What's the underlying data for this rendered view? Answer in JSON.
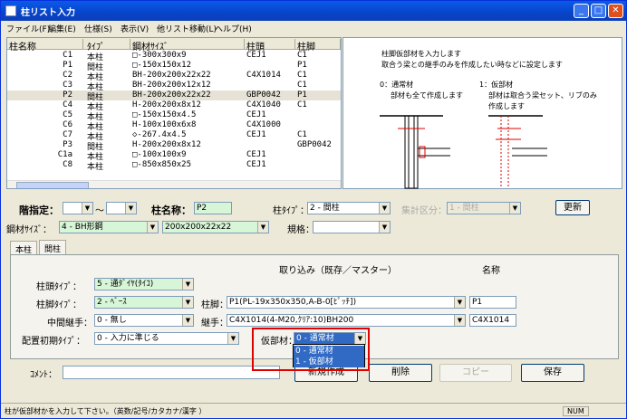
{
  "window": {
    "title": "柱リスト入力"
  },
  "menu": [
    "ファイル(F)",
    "編集(E)",
    "仕様(S)",
    "表示(V)",
    "他リスト移動(L)",
    "ヘルプ(H)"
  ],
  "list": {
    "headers": [
      "柱名称",
      "ﾀｲﾌﾟ",
      "鋼材ｻｲｽﾞ",
      "柱頭",
      "柱脚"
    ],
    "rows": [
      [
        "C1",
        "本柱",
        "□-300x300x9",
        "CEJ1",
        "C1"
      ],
      [
        "P1",
        "間柱",
        "□-150x150x12",
        "",
        "P1"
      ],
      [
        "C2",
        "本柱",
        "BH-200x200x22x22",
        "C4X1014",
        "C1"
      ],
      [
        "C3",
        "本柱",
        "BH-200x200x12x12",
        "",
        "C1"
      ],
      [
        "P2",
        "間柱",
        "BH-200x200x22x22",
        "GBP0042",
        "P1"
      ],
      [
        "C4",
        "本柱",
        "H-200x200x8x12",
        "C4X1040",
        "C1"
      ],
      [
        "C5",
        "本柱",
        "□-150x150x4.5",
        "CEJ1",
        ""
      ],
      [
        "C6",
        "本柱",
        "H-100x100x6x8",
        "C4X1000",
        ""
      ],
      [
        "C7",
        "本柱",
        "◇-267.4x4.5",
        "CEJ1",
        "C1"
      ],
      [
        "P3",
        "間柱",
        "H-200x200x8x12",
        "",
        "GBP0042"
      ],
      [
        "C1a",
        "本柱",
        "□-100x100x9",
        "CEJ1",
        ""
      ],
      [
        "C8",
        "本柱",
        "□-850x850x25",
        "CEJ1",
        ""
      ]
    ]
  },
  "diagram": {
    "note1": "柱脚仮部材を入力します",
    "note2": "取合う梁との継手のみを作成したい時などに設定します",
    "left_title": "0：通常材",
    "left_desc": "部材も全て作成します",
    "right_title": "1：仮部材",
    "right_desc1": "部材は取合う梁セット、リブのみ",
    "right_desc2": "作成します"
  },
  "form": {
    "floor_label": "階指定：",
    "floor_tilde": "～",
    "colname_label": "柱名称：",
    "colname_value": "P2",
    "coltype_label": "柱ﾀｲﾌﾟ：",
    "coltype_value": "2 - 間柱",
    "agg_label": "集計区分：",
    "agg_value": "1 - 間柱",
    "update_button": "更新",
    "steelsize_label": "鋼材ｻｲｽﾞ：",
    "steelsize_type": "4 - BH形鋼",
    "steelsize_value": "200x200x22x22",
    "spec_label": "規格："
  },
  "tabs": [
    "本柱",
    "間柱"
  ],
  "tabpanel": {
    "import_header": "取り込み（既存／マスター）",
    "name_header": "名称",
    "head_type_label": "柱頭ﾀｲﾌﾟ：",
    "head_type_value": "5 - 通ﾀﾞｲﾔ(ﾀｲｺ)",
    "foot_type_label": "柱脚ﾀｲﾌﾟ：",
    "foot_type_value": "2 - ﾍﾞｰｽ",
    "foot_label": "柱脚：",
    "foot_value": "P1(PL-19x350x350,A-B-0[ﾋﾟｯﾁ])",
    "foot_name": "P1",
    "mid_joint_label": "中間継手：",
    "mid_joint_value": "0 - 無し",
    "joint_label": "継手：",
    "joint_value": "C4X1014(4-M20,ｸﾘｱ:10)BH200",
    "joint_name": "C4X1014",
    "initial_label": "配置初期ﾀｲﾌﾟ：",
    "initial_value": "0 - 入力に準じる",
    "temp_label": "仮部材：",
    "temp_value": "0 - 通常材",
    "temp_options": [
      "0 - 通常材",
      "1 - 仮部材"
    ]
  },
  "comment_label": "ｺﾒﾝﾄ：",
  "buttons": {
    "new": "新規作成",
    "delete": "削除",
    "copy": "コピー",
    "save": "保存"
  },
  "status": {
    "message": "柱が仮部材かを入力して下さい。（英数/記号/カタカナ/漢字 ）",
    "num": "NUM"
  }
}
